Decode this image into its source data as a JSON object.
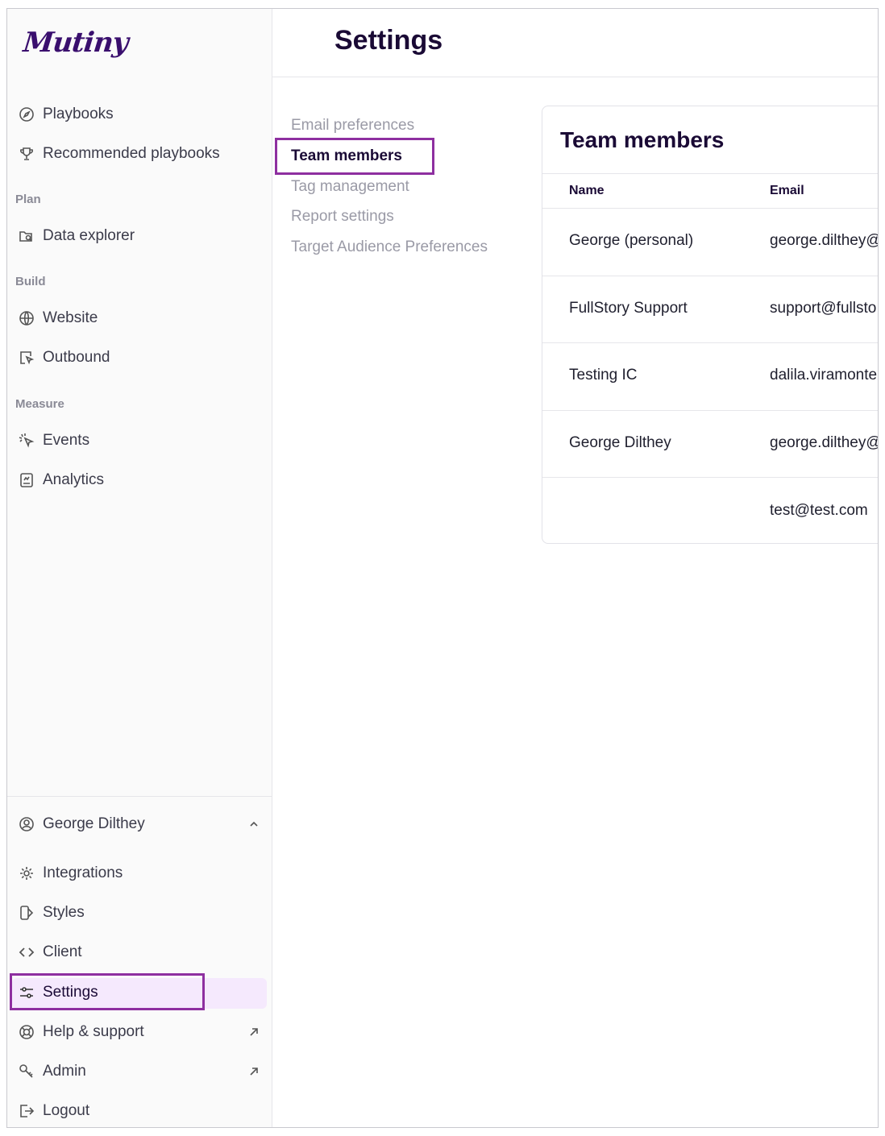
{
  "app": {
    "logo_text": "Mutiny"
  },
  "sidebar": {
    "top_items": [
      {
        "label": "Playbooks",
        "icon": "compass-icon"
      },
      {
        "label": "Recommended playbooks",
        "icon": "trophy-icon"
      }
    ],
    "sections": [
      {
        "label": "Plan",
        "items": [
          {
            "label": "Data explorer",
            "icon": "folder-search-icon"
          }
        ]
      },
      {
        "label": "Build",
        "items": [
          {
            "label": "Website",
            "icon": "globe-icon"
          },
          {
            "label": "Outbound",
            "icon": "outbound-icon"
          }
        ]
      },
      {
        "label": "Measure",
        "items": [
          {
            "label": "Events",
            "icon": "cursor-click-icon"
          },
          {
            "label": "Analytics",
            "icon": "analytics-icon"
          }
        ]
      }
    ],
    "user": {
      "label": "George Dilthey",
      "icon": "user-circle-icon"
    },
    "bottom_items": [
      {
        "label": "Integrations",
        "icon": "gear-icon"
      },
      {
        "label": "Styles",
        "icon": "styles-icon"
      },
      {
        "label": "Client",
        "icon": "code-icon"
      },
      {
        "label": "Settings",
        "icon": "sliders-icon",
        "active": true
      },
      {
        "label": "Help & support",
        "icon": "lifebuoy-icon",
        "external": true
      },
      {
        "label": "Admin",
        "icon": "key-icon",
        "external": true
      },
      {
        "label": "Logout",
        "icon": "logout-icon"
      }
    ]
  },
  "header": {
    "title": "Settings"
  },
  "settings_nav": {
    "items": [
      {
        "label": "Email preferences"
      },
      {
        "label": "Team members",
        "active": true
      },
      {
        "label": "Tag management"
      },
      {
        "label": "Report settings"
      },
      {
        "label": "Target Audience Preferences"
      }
    ]
  },
  "team_card": {
    "title": "Team members",
    "columns": [
      "Name",
      "Email"
    ],
    "rows": [
      {
        "name": "George (personal)",
        "email": "george.dilthey@"
      },
      {
        "name": "FullStory Support",
        "email": "support@fullsto"
      },
      {
        "name": "Testing IC",
        "email": "dalila.viramonte"
      },
      {
        "name": "George Dilthey",
        "email": "george.dilthey@"
      },
      {
        "name": "",
        "email": "test@test.com"
      }
    ]
  },
  "colors": {
    "accent": "#8e2fa0",
    "brand": "#3a0f6e",
    "active_bg": "#f5e9fd"
  }
}
